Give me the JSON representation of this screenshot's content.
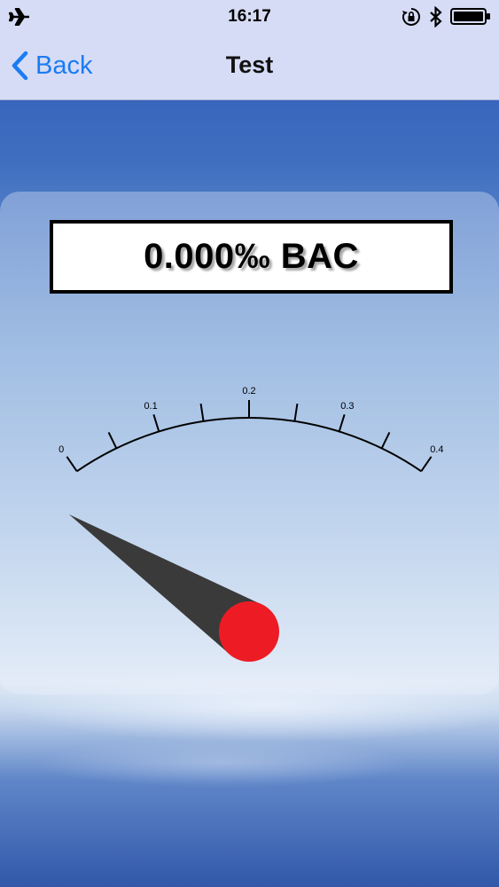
{
  "status_bar": {
    "time": "16:17",
    "left_icons": [
      "airplane-icon"
    ],
    "right_icons": [
      "rotation-lock-icon",
      "bluetooth-icon",
      "battery-icon"
    ]
  },
  "nav": {
    "back_label": "Back",
    "title": "Test"
  },
  "readout": {
    "text": "0.000‰ BAC"
  },
  "gauge": {
    "min": 0,
    "max": 0.4,
    "value": 0,
    "major_ticks": [
      "0",
      "0.1",
      "0.2",
      "0.3",
      "0.4"
    ],
    "minor_ticks_between": 1,
    "needle_color": "#3a3a3a",
    "hub_color": "#ed1c24"
  },
  "colors": {
    "accent": "#1b7cf3",
    "nav_bg": "#d6dcf5"
  }
}
